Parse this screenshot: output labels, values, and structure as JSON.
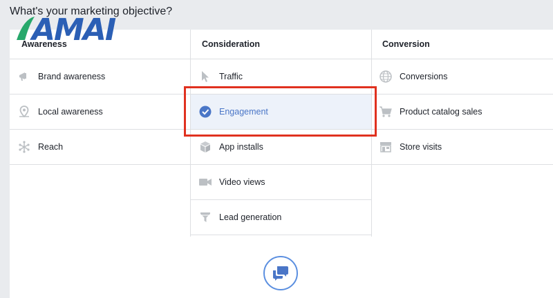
{
  "page": {
    "title": "What's your marketing objective?"
  },
  "logo": {
    "text": "AMAI"
  },
  "columns": [
    {
      "header": "Awareness",
      "items": [
        {
          "label": "Brand awareness",
          "icon": "megaphone-icon"
        },
        {
          "label": "Local awareness",
          "icon": "location-pin-icon"
        },
        {
          "label": "Reach",
          "icon": "reach-burst-icon"
        }
      ]
    },
    {
      "header": "Consideration",
      "items": [
        {
          "label": "Traffic",
          "icon": "cursor-icon"
        },
        {
          "label": "Engagement",
          "icon": "checkmark-circle-icon",
          "selected": true
        },
        {
          "label": "App installs",
          "icon": "box-icon"
        },
        {
          "label": "Video views",
          "icon": "video-camera-icon"
        },
        {
          "label": "Lead generation",
          "icon": "funnel-icon"
        }
      ]
    },
    {
      "header": "Conversion",
      "items": [
        {
          "label": "Conversions",
          "icon": "globe-icon"
        },
        {
          "label": "Product catalog sales",
          "icon": "shopping-cart-icon"
        },
        {
          "label": "Store visits",
          "icon": "store-icon"
        }
      ]
    }
  ],
  "colors": {
    "accent": "#4a76c7",
    "selected_bg": "#edf2fa",
    "highlight_border": "#e0311f",
    "icon_gray": "#bcc0c4"
  },
  "bottom_icon": "chat-bubbles-icon"
}
